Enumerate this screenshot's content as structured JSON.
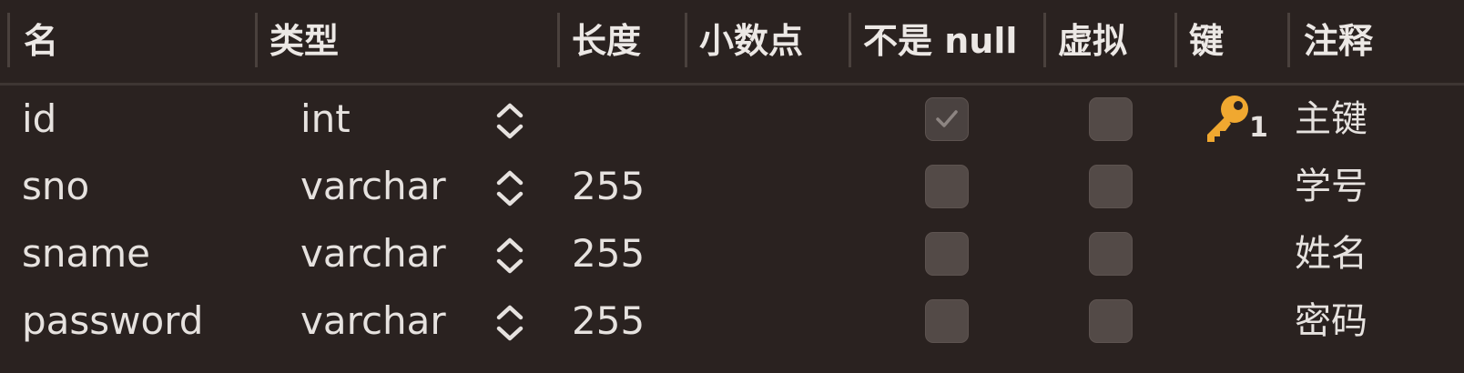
{
  "columns": {
    "name": "名",
    "type": "类型",
    "length": "长度",
    "decimal": "小数点",
    "not_null": "不是 null",
    "virtual": "虚拟",
    "key": "键",
    "comment": "注释"
  },
  "rows": [
    {
      "name": "id",
      "type": "int",
      "length": "",
      "not_null": true,
      "not_null_disabled": true,
      "virtual": false,
      "key": "1",
      "comment": "主键"
    },
    {
      "name": "sno",
      "type": "varchar",
      "length": "255",
      "not_null": false,
      "virtual": false,
      "key": "",
      "comment": "学号"
    },
    {
      "name": "sname",
      "type": "varchar",
      "length": "255",
      "not_null": false,
      "virtual": false,
      "key": "",
      "comment": "姓名"
    },
    {
      "name": "password",
      "type": "varchar",
      "length": "255",
      "not_null": false,
      "virtual": false,
      "key": "",
      "comment": "密码"
    }
  ],
  "icons": {
    "type_stepper": "chevron-up-down-icon",
    "primary_key": "key-icon",
    "check": "checkmark-icon"
  },
  "colors": {
    "background": "#2a2220",
    "key_icon": "#f0a830",
    "checkbox": "#534a47"
  }
}
